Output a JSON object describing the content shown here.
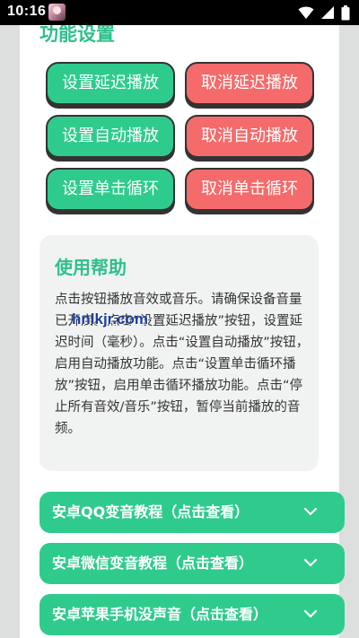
{
  "status_bar": {
    "time": "10:16",
    "icons": [
      "avatar-thumbnail",
      "wifi-icon",
      "signal-icon",
      "battery-icon"
    ]
  },
  "section_title": "功能设置",
  "buttons": {
    "set_delay_play": "设置延迟播放",
    "cancel_delay_play": "取消延迟播放",
    "set_auto_play": "设置自动播放",
    "cancel_auto_play": "取消自动播放",
    "set_single_loop": "设置单击循环",
    "cancel_single_loop": "取消单击循环"
  },
  "help": {
    "title": "使用帮助",
    "body": "点击按钮播放音效或音乐。请确保设备音量已开启。点击“设置延迟播放”按钮，设置延迟时间（毫秒）。点击“设置自动播放”按钮，启用自动播放功能。点击“设置单击循环播放”按钮，启用单击循环播放功能。点击“停止所有音效/音乐”按钮，暂停当前播放的音频。"
  },
  "watermark": "hnlkjr.com",
  "accordions": [
    {
      "label": "安卓QQ变音教程（点击查看）"
    },
    {
      "label": "安卓微信变音教程（点击查看）"
    },
    {
      "label": "安卓苹果手机没声音（点击查看）"
    }
  ],
  "colors": {
    "accent_green": "#2fcb8d",
    "accent_red": "#f56a6a",
    "title_green": "#2ec08b",
    "border_dark": "#333333"
  }
}
